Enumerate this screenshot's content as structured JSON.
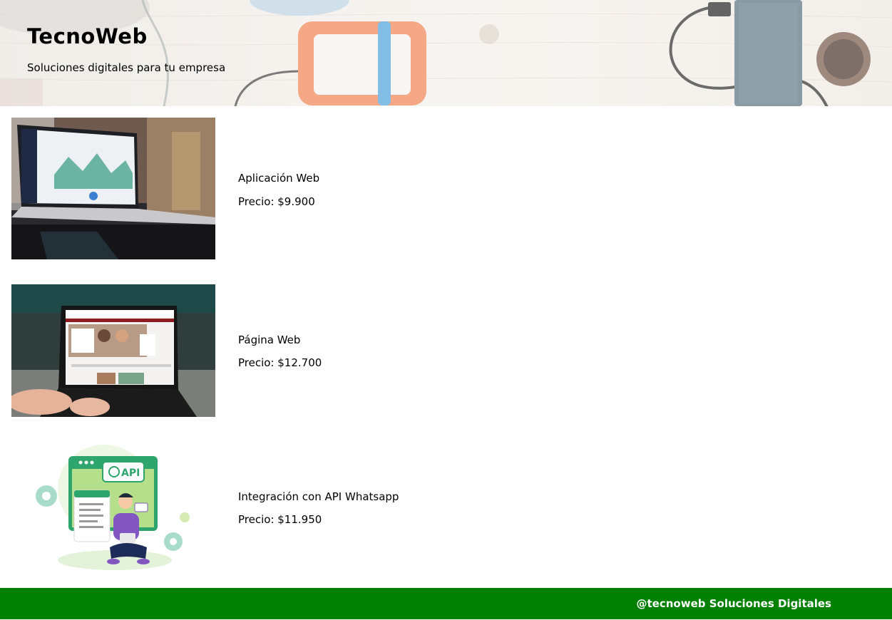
{
  "header": {
    "title": "TecnoWeb",
    "tagline": "Soluciones digitales para tu empresa"
  },
  "products": [
    {
      "name": "Aplicación Web",
      "price": "Precio: $9.900",
      "image": "laptop-dashboard-photo"
    },
    {
      "name": "Página Web",
      "price": "Precio: $12.700",
      "image": "laptop-website-photo"
    },
    {
      "name": "Integración con API Whatsapp",
      "price": "Precio: $11.950",
      "image": "whatsapp-api-illustration",
      "image_badge": "API"
    }
  ],
  "footer": {
    "text": "@tecnoweb Soluciones Digitales"
  },
  "colors": {
    "footer_bg": "#008000",
    "footer_text": "#ffffff"
  }
}
